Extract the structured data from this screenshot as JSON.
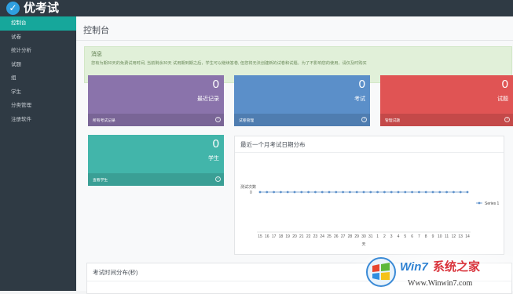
{
  "app": {
    "title": "优考试",
    "logo_icon": "check-circle-icon",
    "accent": "#16a79b",
    "topbar_color": "#2f3a44"
  },
  "sidebar": {
    "items": [
      {
        "label": "控制台",
        "active": true
      },
      {
        "label": "试卷",
        "active": false
      },
      {
        "label": "统计分析",
        "active": false
      },
      {
        "label": "试题",
        "active": false
      },
      {
        "label": "组",
        "active": false
      },
      {
        "label": "学生",
        "active": false
      },
      {
        "label": "分类管理",
        "active": false
      },
      {
        "label": "注册软件",
        "active": false
      }
    ]
  },
  "page": {
    "title": "控制台"
  },
  "alert": {
    "title": "消息",
    "text": "您有为期30天的免费试用时间, 当前剩余30天 试用期到期之后，学生可以继续答卷, 但您将无法创建新的试卷和试题。为了不影响您的使用，请仅及时购买"
  },
  "cards": [
    {
      "value": "0",
      "label": "最近记录",
      "footer": "所有考试记录",
      "color": "#8a73ab",
      "icon": "arrow-circle-icon"
    },
    {
      "value": "0",
      "label": "考试",
      "footer": "试卷管理",
      "color": "#5b8fc9",
      "icon": "arrow-circle-icon"
    },
    {
      "value": "0",
      "label": "试题",
      "footer": "管理试题",
      "color": "#e05454",
      "icon": "arrow-circle-icon"
    },
    {
      "value": "0",
      "label": "学生",
      "footer": "查看学生",
      "color": "#42b5aa",
      "icon": "arrow-circle-icon"
    }
  ],
  "chart_panel": {
    "title": "最近一个月考试日期分布"
  },
  "chart_data": {
    "type": "line",
    "title": "",
    "ylabel": "测试次数",
    "xlabel": "天",
    "ylim": [
      0,
      1
    ],
    "y_ticks": [
      "0"
    ],
    "categories": [
      "15",
      "16",
      "17",
      "18",
      "19",
      "20",
      "21",
      "22",
      "23",
      "24",
      "25",
      "26",
      "27",
      "28",
      "29",
      "30",
      "31",
      "1",
      "2",
      "3",
      "4",
      "5",
      "6",
      "7",
      "8",
      "9",
      "10",
      "11",
      "12",
      "13",
      "14"
    ],
    "series": [
      {
        "name": "Series 1",
        "color": "#5b8fc9",
        "values": [
          0,
          0,
          0,
          0,
          0,
          0,
          0,
          0,
          0,
          0,
          0,
          0,
          0,
          0,
          0,
          0,
          0,
          0,
          0,
          0,
          0,
          0,
          0,
          0,
          0,
          0,
          0,
          0,
          0,
          0,
          0
        ]
      }
    ],
    "legend": "right",
    "grid": false
  },
  "bottom_panel": {
    "title": "考试时间分布(秒)"
  },
  "watermark": {
    "site_cn": "系统之家",
    "brand": "Win7",
    "url": "Www.Winwin7.com",
    "logo_icon": "windows-flag-icon"
  }
}
